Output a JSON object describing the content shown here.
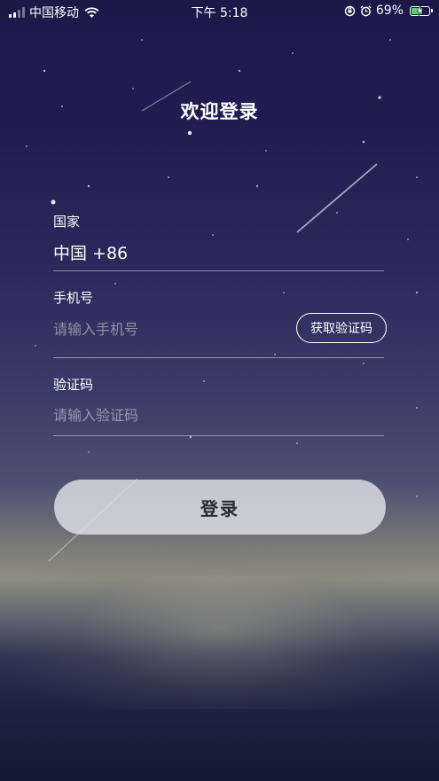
{
  "status_bar": {
    "carrier": "中国移动",
    "time": "下午 5:18",
    "battery_percent": "69%",
    "battery_level": 0.69,
    "icons": [
      "signal-icon",
      "wifi-icon",
      "orientation-lock-icon",
      "alarm-icon",
      "battery-icon",
      "charging-bolt-icon"
    ],
    "battery_color": "#4cd964"
  },
  "title": "欢迎登录",
  "form": {
    "country_label": "国家",
    "country_value": "中国 +86",
    "phone_label": "手机号",
    "phone_placeholder": "请输入手机号",
    "phone_value": "",
    "get_code_label": "获取验证码",
    "code_label": "验证码",
    "code_placeholder": "请输入验证码",
    "code_value": ""
  },
  "login_button_label": "登录"
}
